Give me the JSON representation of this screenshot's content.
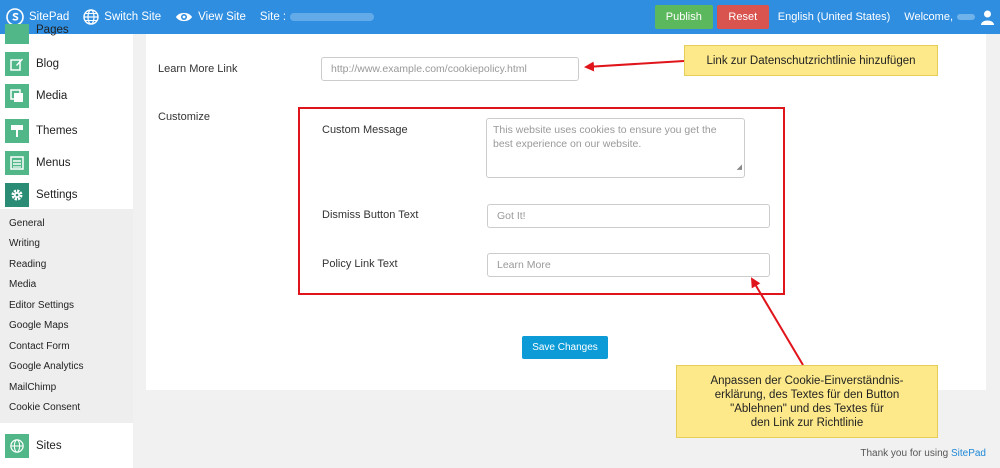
{
  "topbar": {
    "brand": "SitePad",
    "switch_site": "Switch Site",
    "view_site": "View Site",
    "site_label": "Site :",
    "publish": "Publish",
    "reset": "Reset",
    "language": "English (United States)",
    "welcome": "Welcome,"
  },
  "sidebar": {
    "items": [
      {
        "label": "Pages",
        "icon": "pages-icon"
      },
      {
        "label": "Blog",
        "icon": "blog-icon"
      },
      {
        "label": "Media",
        "icon": "media-icon"
      },
      {
        "label": "Themes",
        "icon": "themes-icon"
      },
      {
        "label": "Menus",
        "icon": "menus-icon"
      },
      {
        "label": "Settings",
        "icon": "gear-icon"
      }
    ],
    "submenu": [
      "General",
      "Writing",
      "Reading",
      "Media",
      "Editor Settings",
      "Google Maps",
      "Contact Form",
      "Google Analytics",
      "MailChimp",
      "Cookie Consent"
    ],
    "sites": {
      "label": "Sites",
      "icon": "globe-icon"
    }
  },
  "form": {
    "learn_more_label": "Learn More Link",
    "learn_more_placeholder": "http://www.example.com/cookiepolicy.html",
    "customize_label": "Customize",
    "custom_message_label": "Custom Message",
    "custom_message_placeholder": "This website uses cookies to ensure you get the best experience on our website.",
    "dismiss_label": "Dismiss Button Text",
    "dismiss_placeholder": "Got It!",
    "policy_label": "Policy Link Text",
    "policy_placeholder": "Learn More",
    "save": "Save Changes"
  },
  "annotations": {
    "note1": "Link zur Datenschutzrichtlinie hinzufügen",
    "note2_lines": [
      "Anpassen der Cookie-Einverständnis-",
      "erklärung, des Textes für den Button",
      "\"Ablehnen\" und des Textes für",
      "den Link zur Richtlinie"
    ]
  },
  "footer": {
    "text": "Thank you for using",
    "link": "SitePad"
  },
  "colors": {
    "topbar": "#2f8ee0",
    "publish": "#5cb85c",
    "reset": "#d9534f",
    "save": "#0c9bd7",
    "annotation_red": "#e0141b",
    "note_bg": "#fde98a"
  }
}
